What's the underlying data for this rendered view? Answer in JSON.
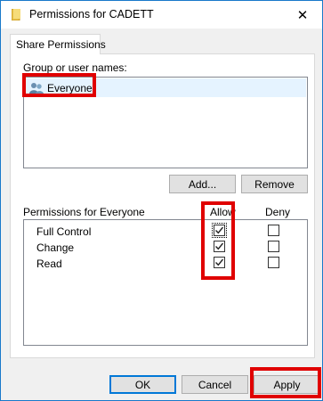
{
  "window": {
    "title": "Permissions for CADETT",
    "close_glyph": "✕"
  },
  "tabs": [
    {
      "label": "Share Permissions",
      "active": true
    }
  ],
  "group_section": {
    "label": "Group or user names:",
    "items": [
      {
        "name": "Everyone",
        "icon": "users-icon",
        "selected": true
      }
    ],
    "add_button": "Add...",
    "remove_button": "Remove"
  },
  "permissions": {
    "header": "Permissions for Everyone",
    "allow_header": "Allow",
    "deny_header": "Deny",
    "rows": [
      {
        "name": "Full Control",
        "allow": true,
        "deny": false
      },
      {
        "name": "Change",
        "allow": true,
        "deny": false
      },
      {
        "name": "Read",
        "allow": true,
        "deny": false
      }
    ]
  },
  "footer": {
    "ok": "OK",
    "cancel": "Cancel",
    "apply": "Apply"
  },
  "colors": {
    "highlight": "#e00000",
    "selection": "#e5f3ff",
    "window_border": "#1979ca",
    "default_button_border": "#0078d7"
  }
}
